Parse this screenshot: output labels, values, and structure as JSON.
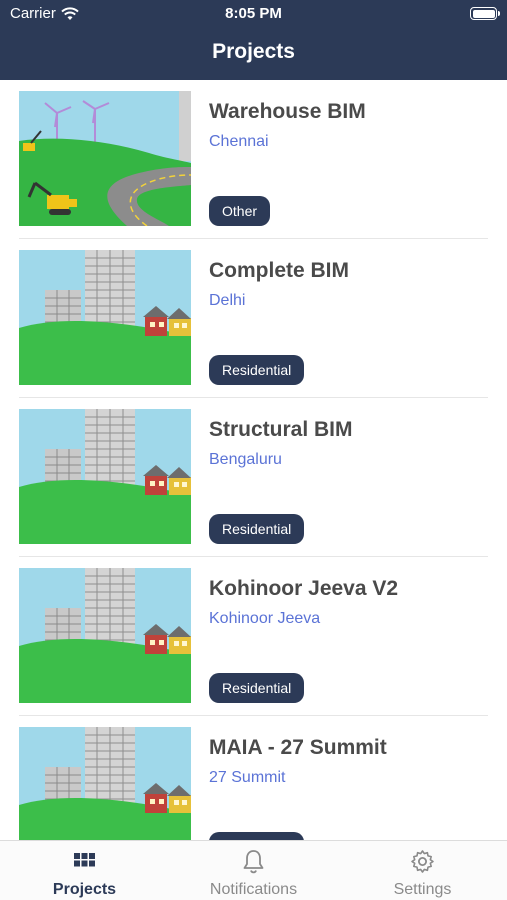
{
  "status_bar": {
    "carrier": "Carrier",
    "time": "8:05 PM"
  },
  "header": {
    "title": "Projects"
  },
  "projects": [
    {
      "name": "Warehouse BIM",
      "location": "Chennai",
      "category": "Other",
      "image": "windmill-road"
    },
    {
      "name": "Complete BIM",
      "location": "Delhi",
      "category": "Residential",
      "image": "city-buildings"
    },
    {
      "name": "Structural BIM",
      "location": "Bengaluru",
      "category": "Residential",
      "image": "city-buildings"
    },
    {
      "name": "Kohinoor Jeeva V2",
      "location": "Kohinoor Jeeva",
      "category": "Residential",
      "image": "city-buildings"
    },
    {
      "name": "MAIA - 27 Summit",
      "location": "27 Summit",
      "category": "",
      "image": "city-buildings"
    }
  ],
  "tabbar": {
    "tabs": [
      {
        "label": "Projects",
        "icon": "grid-icon",
        "active": true
      },
      {
        "label": "Notifications",
        "icon": "bell-icon",
        "active": false
      },
      {
        "label": "Settings",
        "icon": "gear-icon",
        "active": false
      }
    ]
  },
  "colors": {
    "navbar": "#2c3a57",
    "location_link": "#5b73d6",
    "tag_bg": "#2c3a57"
  }
}
